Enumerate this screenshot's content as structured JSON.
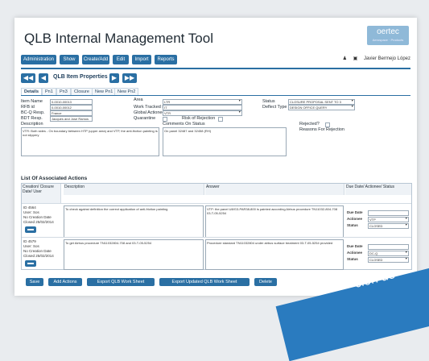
{
  "app": {
    "title": "QLB Internal Management Tool",
    "logo": "oertec",
    "logo_sub": "Aerospace · Products"
  },
  "menu": [
    "Administration",
    "Show",
    "Create/Add",
    "Edit",
    "Import",
    "Reports"
  ],
  "user": {
    "name": "Javier Bermejo López"
  },
  "section": {
    "title": "QLB Item Properties"
  },
  "tabs": [
    "Details",
    "Pn1",
    "Pn3",
    "Closure",
    "New Pn1",
    "New Pn2"
  ],
  "form": {
    "item_name_label": "Item Name",
    "item_name_value": "0-0010-00013",
    "rfb_id_label": "RFB id",
    "rfb_id_value": "0-0010-00012",
    "bcq_resp_label": "BC-Q Resp.",
    "bcq_resp_value": "France",
    "bdt_resp_label": "BDT Resp.",
    "bdt_resp_value": "Jacques and Jose Ramos",
    "area_label": "Area",
    "area_value": "LTR",
    "tracked_by_label": "Work Tracked By",
    "tracked_by_value": "IT",
    "global_actionee_label": "Global Actionee",
    "global_actionee_value": "VTR",
    "quarantine_label": "Quarantine",
    "risk_label": "Risk of Rejection",
    "status_label": "Status",
    "status_value": "CLOSURE PROPOSAL SENT TO 3",
    "deflect_label": "Deflect Type",
    "deflect_value": "DESIGN OFFICE QUERY",
    "description_label": "Description",
    "description_value": "VTR: Both sides - On boundary between HTP (upper area) and VTP, the anti-friction painting is not slippery",
    "comments_label": "Comments On Status",
    "comments_value": "On panel 32487 and 32458 (RH)",
    "rejected_label": "Rejected?",
    "reasons_label": "Reasons For Rejection"
  },
  "actions": {
    "title": "List Of Associated Actions",
    "headers": [
      "Creation/ Closure Date/ User",
      "Description",
      "Answer",
      "Due Date/ Actionee/ Status"
    ],
    "rows": [
      {
        "id": "ID 4564",
        "user": "User: Sos",
        "creation": "No Creation Date",
        "closed": "Closed 25/02/2014",
        "description": "To check against definition the correct application of anti-friction painting",
        "answer": "VTP: the panel U8/G3-PAR38-800 is painted according Airbus procedure TN11032-804-708 03-T-05-5254",
        "due_date_label": "Due Date",
        "actionee_label": "Actionee",
        "actionee": "VTP",
        "status_label": "Status",
        "status": "CLOSED"
      },
      {
        "id": "ID 4579",
        "user": "User: Sos",
        "creation": "No Creation Date",
        "closed": "Closed 25/02/2014",
        "description": "To get Airbus procedure TN11032804-708 and 03-T-05-5254",
        "answer": "Procedure standard TN11032804 under airbus surface treatment 03-T-05-5254 provided",
        "due_date_label": "Due Date",
        "actionee_label": "Actionee",
        "actionee": "DC-Q",
        "status_label": "Status",
        "status": "CLOSED"
      }
    ]
  },
  "buttons": {
    "save": "Save",
    "add_actions": "Add Actions",
    "export_ws": "Export QLB Work Sheet",
    "export_updated_ws": "Export Updated QLB Work Sheet",
    "delete": "Delete"
  },
  "banner": {
    "text": "ción de"
  },
  "colors": {
    "primary": "#2a6fa3",
    "banner": "#2a7bbf",
    "logo": "#8fb9d8"
  }
}
